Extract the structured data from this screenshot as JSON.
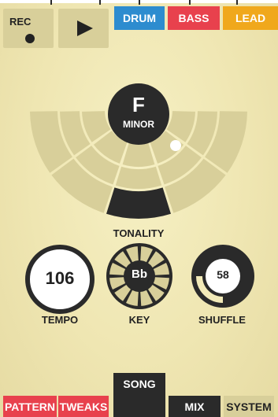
{
  "transport": {
    "rec_label": "REC",
    "play_label": ""
  },
  "instruments": [
    {
      "label": "DRUM",
      "color": "#2d8ccf"
    },
    {
      "label": "BASS",
      "color": "#e8414d"
    },
    {
      "label": "LEAD",
      "color": "#f0a81c"
    }
  ],
  "tonality": {
    "note": "F",
    "mode": "MINOR",
    "label": "TONALITY"
  },
  "controls": {
    "tempo": {
      "value": "106",
      "label": "TEMPO"
    },
    "key": {
      "value": "Bb",
      "label": "KEY"
    },
    "shuffle": {
      "value": "58",
      "label": "SHUFFLE",
      "level_percent": 58
    }
  },
  "tabs": [
    {
      "label": "PATTERN",
      "color": "#e8414d"
    },
    {
      "label": "TWEAKS",
      "color": "#e8414d"
    },
    {
      "label": "SONG",
      "color": "#2a2a2a"
    },
    {
      "label": "MIX",
      "color": "#2a2a2a"
    },
    {
      "label": "SYSTEM",
      "color": "#d8cf9a"
    }
  ],
  "colors": {
    "accent_dark": "#2a2a2a",
    "segment": "#d8cf9a",
    "background": "#f2eab8"
  }
}
